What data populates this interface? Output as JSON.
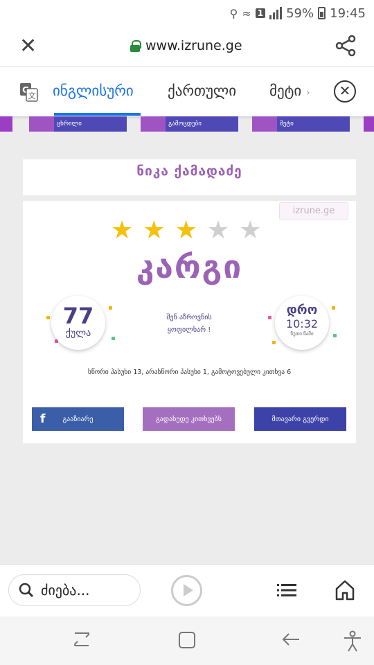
{
  "status_bar": {
    "sim": "1",
    "battery": "59%",
    "time": "19:45"
  },
  "url_bar": {
    "url": "www.izrune.ge",
    "icons": [
      "close-icon",
      "lock-icon",
      "share-icon"
    ]
  },
  "translate_bar": {
    "tabs": [
      "ინგლისური",
      "ქართული",
      "მეტი"
    ],
    "active_tab": "ინგლისური",
    "more_chevron": "›"
  },
  "site_nav": {
    "tiles": [
      "ცხრილი",
      "გამოცდები",
      "მეტი"
    ]
  },
  "user": {
    "name": "ნიკა ქამადაძე"
  },
  "result": {
    "watermark": "izrune.ge",
    "stars_total": 5,
    "stars_filled": 3,
    "grade": "კარგი",
    "score_value": "77",
    "score_unit": "ქულა",
    "message_line1": "შენ აზროვნის",
    "message_line2": "ყოფილხარ !",
    "time_label": "დრო",
    "time_value": "10:32",
    "time_sub": "წუთი წამი",
    "stats": "სწორი პასუხი 13, არასწორი პასუხი 1, გამოტოვებული კითხვა 6",
    "buttons": {
      "share": "გააზიარე",
      "answers": "გადახედე კითხვებს",
      "home": "მთავარი გვერდი"
    }
  },
  "toolbar": {
    "search_placeholder": "ძიება...",
    "icons": [
      "search-icon",
      "play-icon",
      "menu-icon",
      "home-icon"
    ]
  },
  "colors": {
    "accent_purple": "#9b62b6",
    "facebook": "#3b5ea8",
    "home_button": "#3d42a8",
    "answers_button": "#a56fc0",
    "star_on": "#f4c20d",
    "link_blue": "#1a73e8"
  }
}
